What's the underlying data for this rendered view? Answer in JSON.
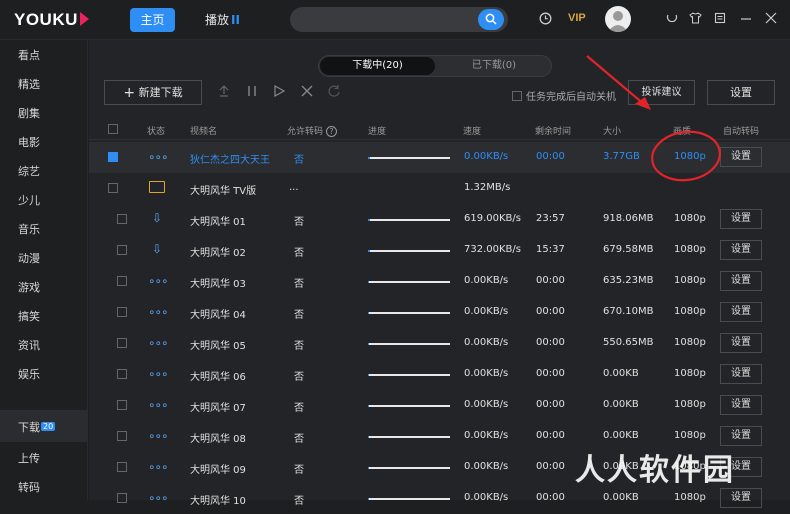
{
  "header": {
    "logo": "YOUKU",
    "nav_home": "主页",
    "nav_play": "播放",
    "vip": "VIP"
  },
  "sidebar": {
    "items": [
      "看点",
      "精选",
      "剧集",
      "电影",
      "综艺",
      "少儿",
      "音乐",
      "动漫",
      "游戏",
      "搞笑",
      "资讯",
      "娱乐"
    ],
    "bottom": [
      "下载",
      "上传",
      "转码"
    ],
    "download_badge": "20"
  },
  "tabs": {
    "downloading": "下载中(20)",
    "downloaded": "已下载(0)"
  },
  "toolbar": {
    "new_download": "新建下载",
    "auto_shutdown": "任务完成后自动关机",
    "feedback": "投诉建议",
    "settings": "设置"
  },
  "columns": {
    "status": "状态",
    "name": "视频名",
    "transcode": "允许转码",
    "progress": "进度",
    "speed": "速度",
    "remaining": "剩余时间",
    "size": "大小",
    "quality": "画质",
    "auto_transcode": "自动转码"
  },
  "rows": [
    {
      "name": "狄仁杰之四大天王",
      "transcode": "否",
      "progress": 0.03,
      "speed": "0.00KB/s",
      "remaining": "00:00",
      "size": "3.77GB",
      "quality": "1080p",
      "set": "设置",
      "status": "dots",
      "selected": true
    },
    {
      "name": "大明风华 TV版",
      "extra": "...",
      "speed": "1.32MB/s",
      "status": "folder"
    },
    {
      "name": "大明风华 01",
      "transcode": "否",
      "progress": 0.02,
      "speed": "619.00KB/s",
      "remaining": "23:57",
      "size": "918.06MB",
      "quality": "1080p",
      "set": "设置",
      "status": "arrow"
    },
    {
      "name": "大明风华 02",
      "transcode": "否",
      "progress": 0.02,
      "speed": "732.00KB/s",
      "remaining": "15:37",
      "size": "679.58MB",
      "quality": "1080p",
      "set": "设置",
      "status": "arrow"
    },
    {
      "name": "大明风华 03",
      "transcode": "否",
      "progress": 0,
      "speed": "0.00KB/s",
      "remaining": "00:00",
      "size": "635.23MB",
      "quality": "1080p",
      "set": "设置",
      "status": "dots"
    },
    {
      "name": "大明风华 04",
      "transcode": "否",
      "progress": 0,
      "speed": "0.00KB/s",
      "remaining": "00:00",
      "size": "670.10MB",
      "quality": "1080p",
      "set": "设置",
      "status": "dots"
    },
    {
      "name": "大明风华 05",
      "transcode": "否",
      "progress": 0,
      "speed": "0.00KB/s",
      "remaining": "00:00",
      "size": "550.65MB",
      "quality": "1080p",
      "set": "设置",
      "status": "dots"
    },
    {
      "name": "大明风华 06",
      "transcode": "否",
      "progress": 0,
      "speed": "0.00KB/s",
      "remaining": "00:00",
      "size": "0.00KB",
      "quality": "1080p",
      "set": "设置",
      "status": "dots"
    },
    {
      "name": "大明风华 07",
      "transcode": "否",
      "progress": 0,
      "speed": "0.00KB/s",
      "remaining": "00:00",
      "size": "0.00KB",
      "quality": "1080p",
      "set": "设置",
      "status": "dots"
    },
    {
      "name": "大明风华 08",
      "transcode": "否",
      "progress": 0,
      "speed": "0.00KB/s",
      "remaining": "00:00",
      "size": "0.00KB",
      "quality": "1080p",
      "set": "设置",
      "status": "dots"
    },
    {
      "name": "大明风华 09",
      "transcode": "否",
      "progress": 0,
      "speed": "0.00KB/s",
      "remaining": "00:00",
      "size": "0.00KB",
      "quality": "1080p",
      "set": "设置",
      "status": "dots"
    },
    {
      "name": "大明风华 10",
      "transcode": "否",
      "progress": 0,
      "speed": "0.00KB/s",
      "remaining": "00:00",
      "size": "0.00KB",
      "quality": "1080p",
      "set": "设置",
      "status": "dots"
    }
  ],
  "watermark": "人人软件园",
  "colors": {
    "accent": "#2f8ef4",
    "annotation": "#e0242a",
    "folder": "#e2a32b"
  }
}
